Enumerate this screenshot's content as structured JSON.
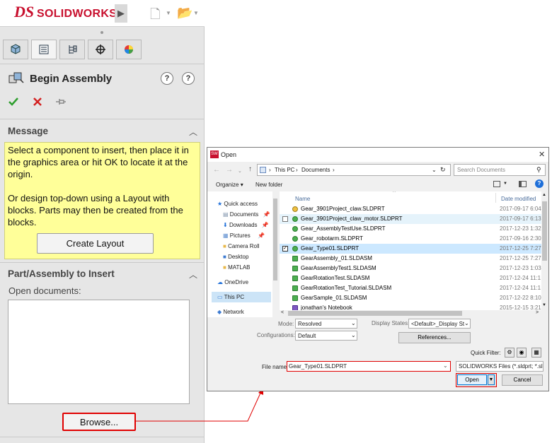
{
  "solidworks": {
    "logo_ds": "DS",
    "logo_solid": "SOLID",
    "logo_works": "WORKS",
    "pm_title": "Begin Assembly",
    "message": {
      "heading": "Message",
      "text": "Select a component to insert, then place it in the graphics area or hit OK to locate it at the origin.\n\nOr design top-down using a Layout with blocks. Parts may then be created from the blocks."
    },
    "create_layout_label": "Create Layout",
    "part_section": {
      "heading": "Part/Assembly to Insert",
      "open_docs_label": "Open documents:"
    },
    "browse_label": "Browse...",
    "colors": {
      "brand": "#c8102e",
      "message_bg": "#ffff99",
      "highlight": "#e00000"
    }
  },
  "dialog": {
    "title": "Open",
    "breadcrumb": [
      "This PC",
      "Documents"
    ],
    "search_placeholder": "Search Documents",
    "organize_label": "Organize",
    "new_folder_label": "New folder",
    "nav_items": [
      "Quick access",
      "Documents",
      "Downloads",
      "Pictures",
      "Camera Roll",
      "Desktop",
      "MATLAB",
      "OneDrive",
      "This PC",
      "Network"
    ],
    "columns": {
      "name": "Name",
      "date": "Date modified"
    },
    "files": [
      {
        "name": "Gear_3901Project_claw.SLDPRT",
        "date": "2017-09-17 6:04"
      },
      {
        "name": "Gear_3901Project_claw_motor.SLDPRT",
        "date": "2017-09-17 6:13"
      },
      {
        "name": "Gear_AssemblyTestUse.SLDPRT",
        "date": "2017-12-23 1:32"
      },
      {
        "name": "Gear_robotarm.SLDPRT",
        "date": "2017-09-16 2:30"
      },
      {
        "name": "Gear_Type01.SLDPRT",
        "date": "2017-12-25 7:27"
      },
      {
        "name": "GearAssembly_01.SLDASM",
        "date": "2017-12-25 7:27"
      },
      {
        "name": "GearAssemblyTest1.SLDASM",
        "date": "2017-12-23 1:03"
      },
      {
        "name": "GearRotationTest.SLDASM",
        "date": "2017-12-24 11:1"
      },
      {
        "name": "GearRotationTest_Tutorial.SLDASM",
        "date": "2017-12-24 11:1"
      },
      {
        "name": "GearSample_01.SLDASM",
        "date": "2017-12-22 8:10"
      },
      {
        "name": "jonathan's Notebook",
        "date": "2015-12-15 3:21"
      }
    ],
    "mode_label": "Mode:",
    "mode_value": "Resolved",
    "configurations_label": "Configurations:",
    "configurations_value": "Default",
    "display_states_label": "Display States:",
    "display_states_value": "<Default>_Display St",
    "references_label": "References...",
    "quick_filter_label": "Quick Filter:",
    "file_name_label": "File name:",
    "file_name_value": "Gear_Type01.SLDPRT",
    "file_type_value": "SOLIDWORKS Files (*.sldprt; *.sl",
    "open_label": "Open",
    "cancel_label": "Cancel"
  }
}
